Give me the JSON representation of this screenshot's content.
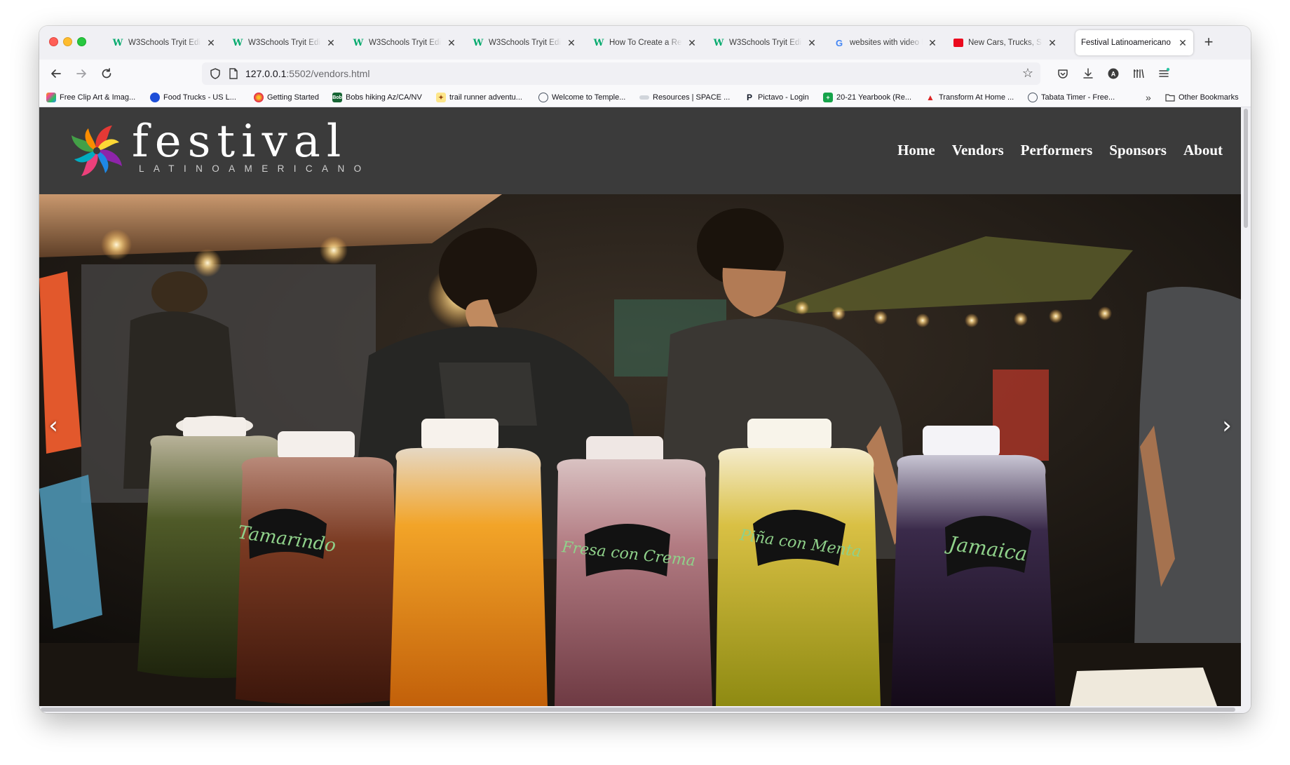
{
  "browser": {
    "tabs": [
      {
        "title": "W3Schools Tryit Edito",
        "favicon": "w3schools-icon"
      },
      {
        "title": "W3Schools Tryit Edito",
        "favicon": "w3schools-icon"
      },
      {
        "title": "W3Schools Tryit Edito",
        "favicon": "w3schools-icon"
      },
      {
        "title": "W3Schools Tryit Edito",
        "favicon": "w3schools-icon"
      },
      {
        "title": "How To Create a Resp",
        "favicon": "w3schools-icon"
      },
      {
        "title": "W3Schools Tryit Edito",
        "favicon": "w3schools-icon"
      },
      {
        "title": "websites with video h",
        "favicon": "google-icon"
      },
      {
        "title": "New Cars, Trucks, SU",
        "favicon": "toyota-icon"
      },
      {
        "title": "Festival Latinoamericano",
        "favicon": "none",
        "active": true
      }
    ],
    "url": {
      "host": "127.0.0.1",
      "rest": ":5502/vendors.html"
    },
    "bookmarks": [
      {
        "label": "Free Clip Art & Imag...",
        "color": "#f59e0b"
      },
      {
        "label": "Food Trucks - US L...",
        "color": "#1d4ed8"
      },
      {
        "label": "Getting Started",
        "color": "#e11d48"
      },
      {
        "label": "Bobs hiking Az/CA/NV",
        "color": "#166534"
      },
      {
        "label": "trail runner adventu...",
        "color": "#92400e"
      },
      {
        "label": "Welcome to Temple...",
        "color": "#4b5563"
      },
      {
        "label": "Resources | SPACE ...",
        "color": "#9ca3af"
      },
      {
        "label": "Pictavo - Login",
        "color": "#111827"
      },
      {
        "label": "20-21 Yearbook (Re...",
        "color": "#16a34a"
      },
      {
        "label": "Transform At Home ...",
        "color": "#dc2626"
      },
      {
        "label": "Tabata Timer - Free...",
        "color": "#4b5563"
      }
    ],
    "other_bookmarks": "Other Bookmarks"
  },
  "site": {
    "logo": {
      "word": "festival",
      "sub": "LATINOAMERICANO"
    },
    "nav": [
      "Home",
      "Vendors",
      "Performers",
      "Sponsors",
      "About"
    ],
    "hero": {
      "jar_labels": [
        "Tamarindo",
        "Fresa con Crema",
        "Piña con Menta",
        "Jamaica"
      ],
      "prev": "‹",
      "next": "›"
    }
  }
}
